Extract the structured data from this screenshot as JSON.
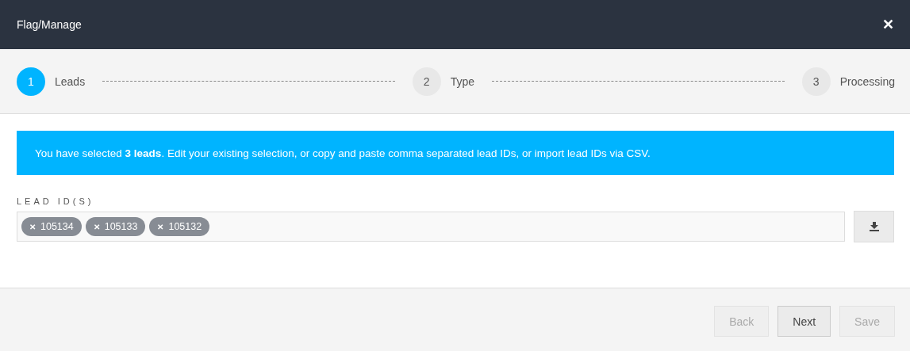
{
  "window": {
    "title": "Flag/Manage",
    "close": "✕"
  },
  "steps": [
    {
      "number": "1",
      "label": "Leads",
      "selected": true
    },
    {
      "number": "2",
      "label": "Type",
      "selected": false
    },
    {
      "number": "3",
      "label": "Processing",
      "selected": false
    }
  ],
  "notice": "You have selected **3 leads**. Edit your existing selection, or copy and paste comma separated lead IDs, or import lead IDs via CSV.",
  "field": {
    "label": "LEAD ID(S)",
    "tags": [
      {
        "remove": "✕",
        "value": "105134"
      },
      {
        "remove": "✕",
        "value": "105133"
      },
      {
        "remove": "✕",
        "value": "105132"
      }
    ]
  },
  "buttons": [
    {
      "label": "Back",
      "disabled": true
    },
    {
      "label": "Next",
      "disabled": false
    },
    {
      "label": "Save",
      "disabled": true
    }
  ]
}
